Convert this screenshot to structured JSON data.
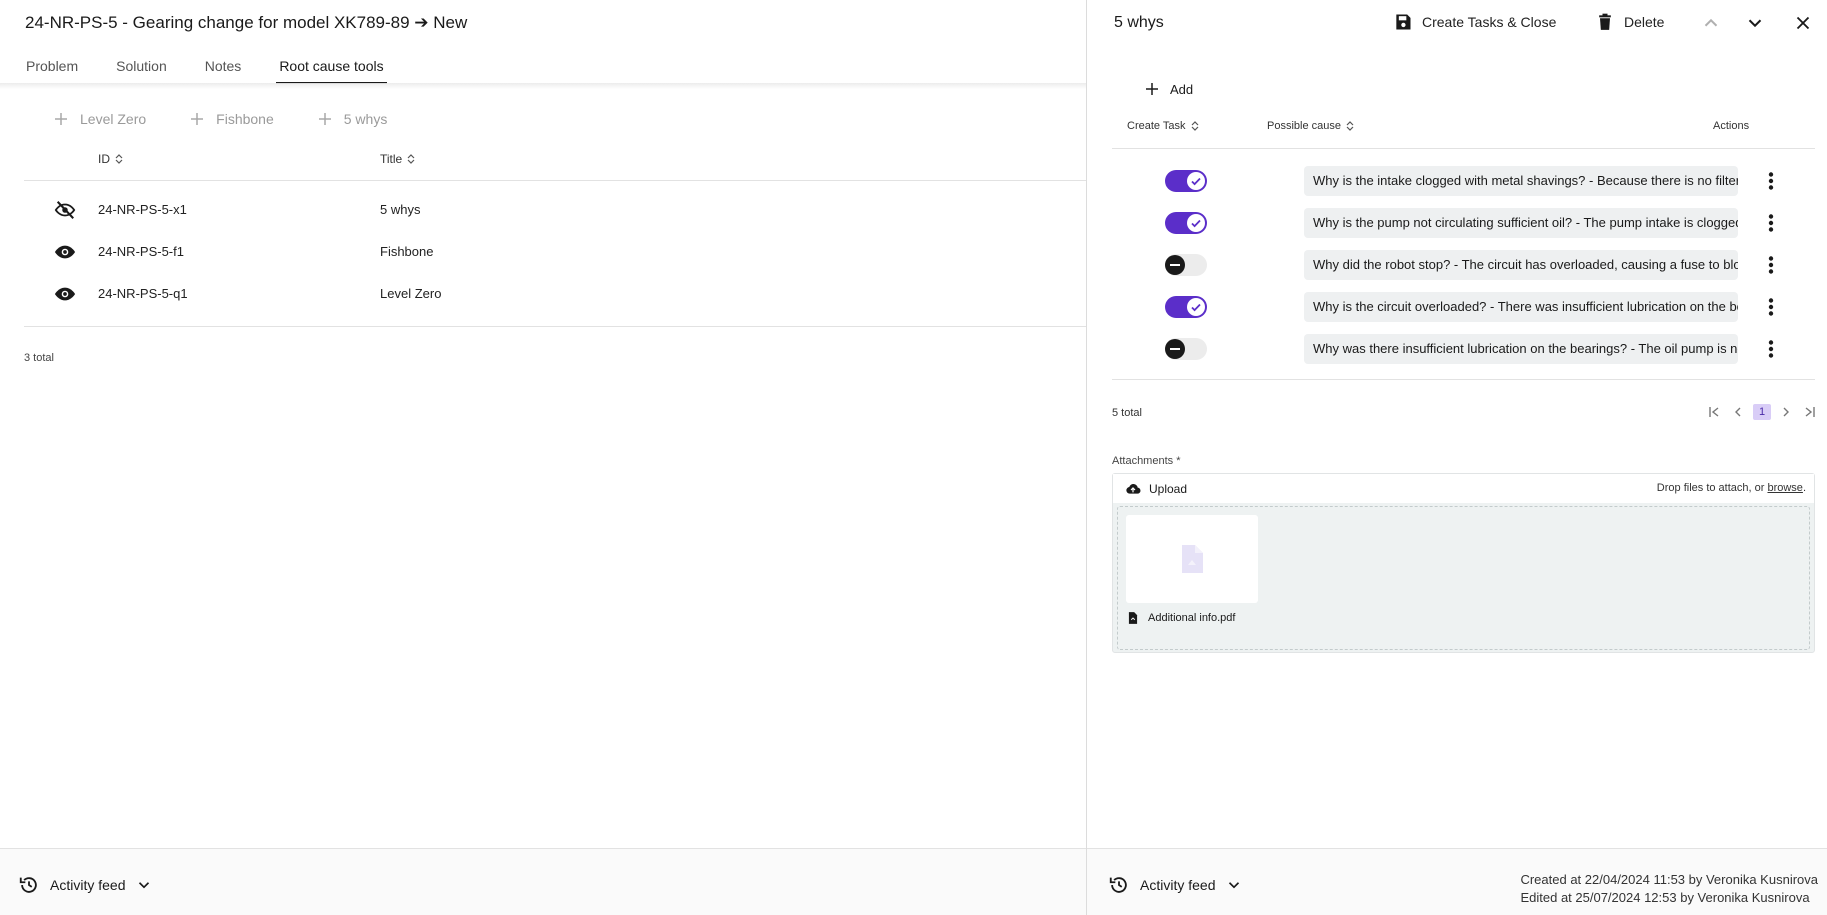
{
  "left": {
    "title": "24-NR-PS-5 - Gearing change for model XK789-89 ➔ New",
    "tabs": [
      {
        "label": "Problem",
        "active": false
      },
      {
        "label": "Solution",
        "active": false
      },
      {
        "label": "Notes",
        "active": false
      },
      {
        "label": "Root cause tools",
        "active": true
      }
    ],
    "add_buttons": [
      "Level Zero",
      "Fishbone",
      "5 whys"
    ],
    "columns": {
      "id": "ID",
      "title": "Title"
    },
    "rows": [
      {
        "id": "24-NR-PS-5-x1",
        "title": "5 whys",
        "icon": "eye-off-icon"
      },
      {
        "id": "24-NR-PS-5-f1",
        "title": "Fishbone",
        "icon": "eye-icon"
      },
      {
        "id": "24-NR-PS-5-q1",
        "title": "Level Zero",
        "icon": "eye-icon"
      }
    ],
    "total": "3 total",
    "activity_feed": "Activity feed"
  },
  "right": {
    "title": "5 whys",
    "toolbar": {
      "create_close": "Create Tasks & Close",
      "delete": "Delete"
    },
    "add_label": "Add",
    "columns": {
      "create_task": "Create Task",
      "possible_cause": "Possible cause",
      "actions": "Actions"
    },
    "causes": [
      {
        "create_task": true,
        "text": "Why is the intake clogged with metal shavings? - Because there is no filter on the pump"
      },
      {
        "create_task": true,
        "text": "Why is the pump not circulating sufficient oil? - The pump intake is clogged with metal shavings"
      },
      {
        "create_task": false,
        "text": "Why did the robot stop? - The circuit has overloaded, causing a fuse to blow"
      },
      {
        "create_task": true,
        "text": "Why is the circuit overloaded? - There was insufficient lubrication on the bearings"
      },
      {
        "create_task": false,
        "text": "Why was there insufficient lubrication on the bearings? - The oil pump is not circulating"
      }
    ],
    "total": "5 total",
    "current_page": "1",
    "attachments": {
      "label": "Attachments *",
      "upload": "Upload",
      "drop_text": "Drop files to attach, or ",
      "browse": "browse",
      "drop_suffix": ".",
      "files": [
        {
          "name": "Additional info.pdf"
        }
      ]
    },
    "activity_feed": "Activity feed",
    "created": "Created at 22/04/2024 11:53 by Veronika Kusnirova",
    "edited": "Edited at 25/07/2024 12:53 by Veronika Kusnirova"
  },
  "colors": {
    "accent": "#5b2ec9",
    "page_highlight": "#d9cdf7",
    "cause_bg": "#eef0f1"
  }
}
